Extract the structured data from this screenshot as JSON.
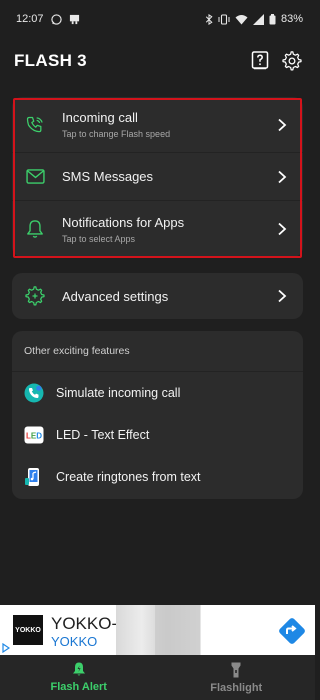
{
  "status_bar": {
    "time": "12:07",
    "battery": "83%"
  },
  "header": {
    "title": "FLASH 3"
  },
  "main_card": {
    "items": [
      {
        "title": "Incoming call",
        "subtitle": "Tap to change Flash speed"
      },
      {
        "title": "SMS Messages",
        "subtitle": ""
      },
      {
        "title": "Notifications for Apps",
        "subtitle": "Tap to select Apps"
      }
    ]
  },
  "advanced": {
    "label": "Advanced settings"
  },
  "other": {
    "heading": "Other exciting features",
    "items": [
      {
        "label": "Simulate incoming call"
      },
      {
        "label": "LED - Text Effect"
      },
      {
        "label": "Create ringtones from text"
      }
    ]
  },
  "ad": {
    "logo_text": "YOKKO",
    "title": "YOKKO-",
    "subtitle": "YOKKO"
  },
  "bottom_nav": [
    {
      "label": "Flash Alert"
    },
    {
      "label": "Flashlight"
    }
  ],
  "colors": {
    "accent": "#3ccf6b",
    "highlight": "#d3131b",
    "card": "#2c2c2c",
    "background": "#1f1f1f"
  }
}
